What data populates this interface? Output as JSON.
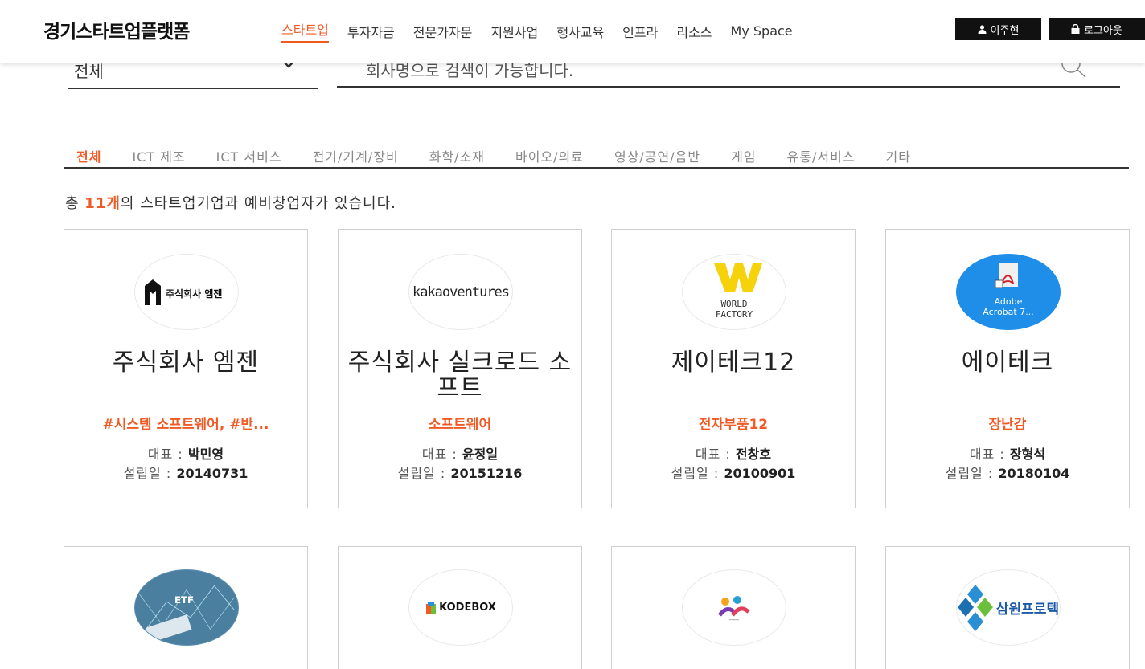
{
  "brand": {
    "title": "경기스타트업플랫폼",
    "accent": "#f15a24"
  },
  "nav": {
    "items": [
      "스타트업",
      "투자자금",
      "전문가자문",
      "지원사업",
      "행사교육",
      "인프라",
      "리소스",
      "My Space"
    ],
    "active": "스타트업"
  },
  "user": {
    "name": "이주현",
    "logout": "로그아웃"
  },
  "search": {
    "select_value": "전체",
    "placeholder": "회사명으로 검색이 가능합니다."
  },
  "categories": {
    "items": [
      "전체",
      "ICT 제조",
      "ICT 서비스",
      "전기/기계/장비",
      "화학/소재",
      "바이오/의료",
      "영상/공연/음반",
      "게임",
      "유통/서비스",
      "기타"
    ],
    "active": "전체"
  },
  "summary": {
    "prefix": "총 ",
    "count": "11개",
    "suffix": "의 스타트업기업과 예비창업자가 있습니다."
  },
  "labels": {
    "ceo": "대표 : ",
    "founded": "설립일 : "
  },
  "cards": [
    {
      "logo_text": "주식회사 엠젠",
      "name": "주식회사 엠젠",
      "tag": "#시스템 소프트웨어, #반...",
      "ceo": "박민영",
      "founded": "20140731"
    },
    {
      "logo_text": "kakaoventures",
      "name": "주식회사 실크로드 소프트",
      "tag": "소프트웨어",
      "ceo": "윤정일",
      "founded": "20151216"
    },
    {
      "logo_text": "WORLD FACTORY",
      "name": "제이테크12",
      "tag": "전자부품12",
      "ceo": "전창호",
      "founded": "20100901"
    },
    {
      "logo_text": "Adobe Acrobat 7...",
      "name": "에이테크",
      "tag": "장난감",
      "ceo": "장형석",
      "founded": "20180104"
    }
  ],
  "cards_row2": [
    {
      "logo_text": "ETF"
    },
    {
      "logo_text": "KODEBOX"
    },
    {
      "logo_text": ""
    },
    {
      "logo_text": "삼원프로텍"
    }
  ]
}
